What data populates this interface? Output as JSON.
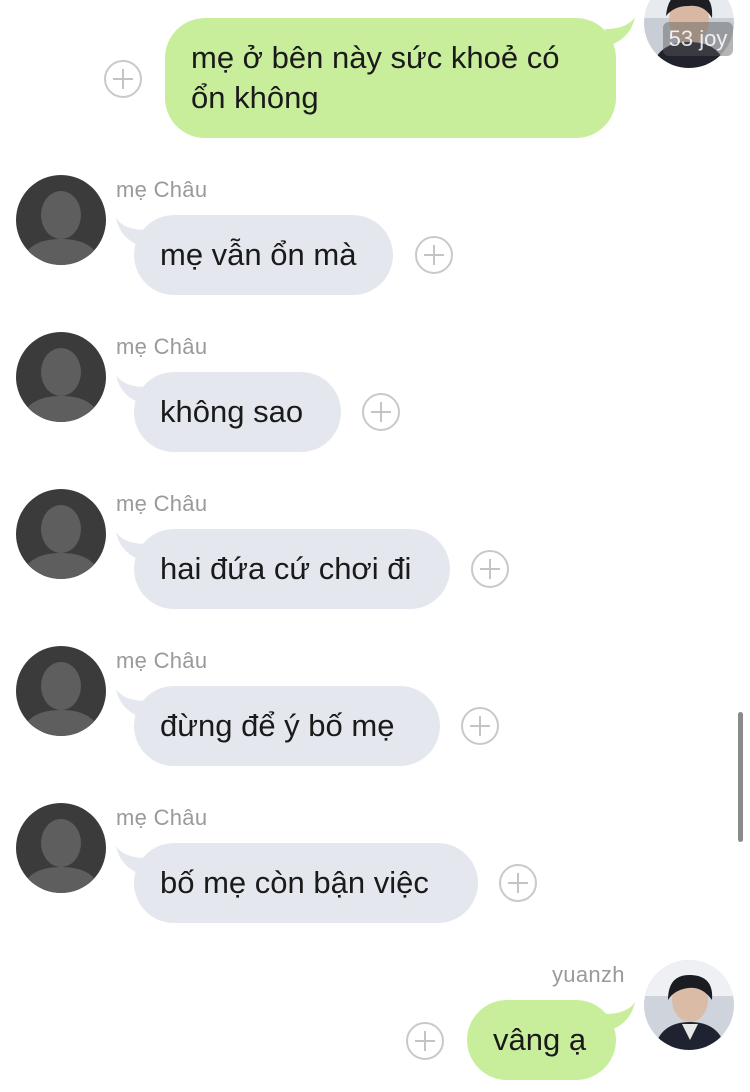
{
  "watermark": {
    "text": "53 joy"
  },
  "messages": [
    {
      "direction": "outgoing",
      "text": "mẹ ở bên này sức khoẻ có\nổn không"
    },
    {
      "direction": "incoming",
      "sender": "mẹ Châu",
      "text": "mẹ vẫn ổn mà"
    },
    {
      "direction": "incoming",
      "sender": "mẹ Châu",
      "text": "không sao"
    },
    {
      "direction": "incoming",
      "sender": "mẹ Châu",
      "text": "hai đứa cứ chơi đi"
    },
    {
      "direction": "incoming",
      "sender": "mẹ Châu",
      "text": "đừng để ý bố mẹ"
    },
    {
      "direction": "incoming",
      "sender": "mẹ Châu",
      "text": "bố mẹ còn bận việc"
    },
    {
      "direction": "outgoing",
      "sender": "yuanzh",
      "text": "vâng ạ"
    }
  ],
  "colors": {
    "incoming_bubble": "#e4e8ee",
    "outgoing_bubble": "#c8ee9c",
    "sender_text": "#9a9a9a",
    "background": "#ffffff"
  },
  "icons": {
    "react_button": "plus-circle-icon",
    "default_avatar": "person-silhouette-icon"
  }
}
